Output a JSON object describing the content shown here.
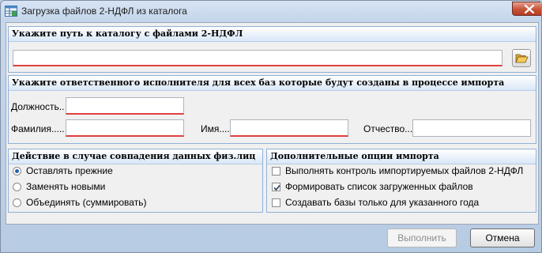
{
  "window": {
    "title": "Загрузка файлов 2-НДФЛ из каталога"
  },
  "path_group": {
    "header": "Укажите путь к каталогу с файлами 2-НДФЛ",
    "path_value": ""
  },
  "executor_group": {
    "header": "Укажите ответственного исполнителя для всех баз которые будут созданы в процессе импорта",
    "position_label": "Должность..",
    "lastname_label": "Фамилия.....",
    "firstname_label": "Имя.....",
    "patronymic_label": "Отчество.....",
    "position_value": "",
    "lastname_value": "",
    "firstname_value": "",
    "patronymic_value": ""
  },
  "match_group": {
    "header": "Действие в случае совпадения данных физ.лиц",
    "options": [
      {
        "label": "Оставлять прежние",
        "selected": true
      },
      {
        "label": "Заменять новыми",
        "selected": false
      },
      {
        "label": "Объединять (суммировать)",
        "selected": false
      }
    ]
  },
  "options_group": {
    "header": "Дополнительные опции импорта",
    "options": [
      {
        "label": "Выполнять контроль импортируемых файлов 2-НДФЛ",
        "checked": false
      },
      {
        "label": "Формировать список загруженных файлов",
        "checked": true
      },
      {
        "label": "Создавать базы только для указанного года",
        "checked": false
      }
    ]
  },
  "footer": {
    "run_label": "Выполнить",
    "cancel_label": "Отмена"
  },
  "icons": {
    "app": "app-table-icon",
    "close": "close-icon",
    "folder": "folder-open-icon"
  }
}
